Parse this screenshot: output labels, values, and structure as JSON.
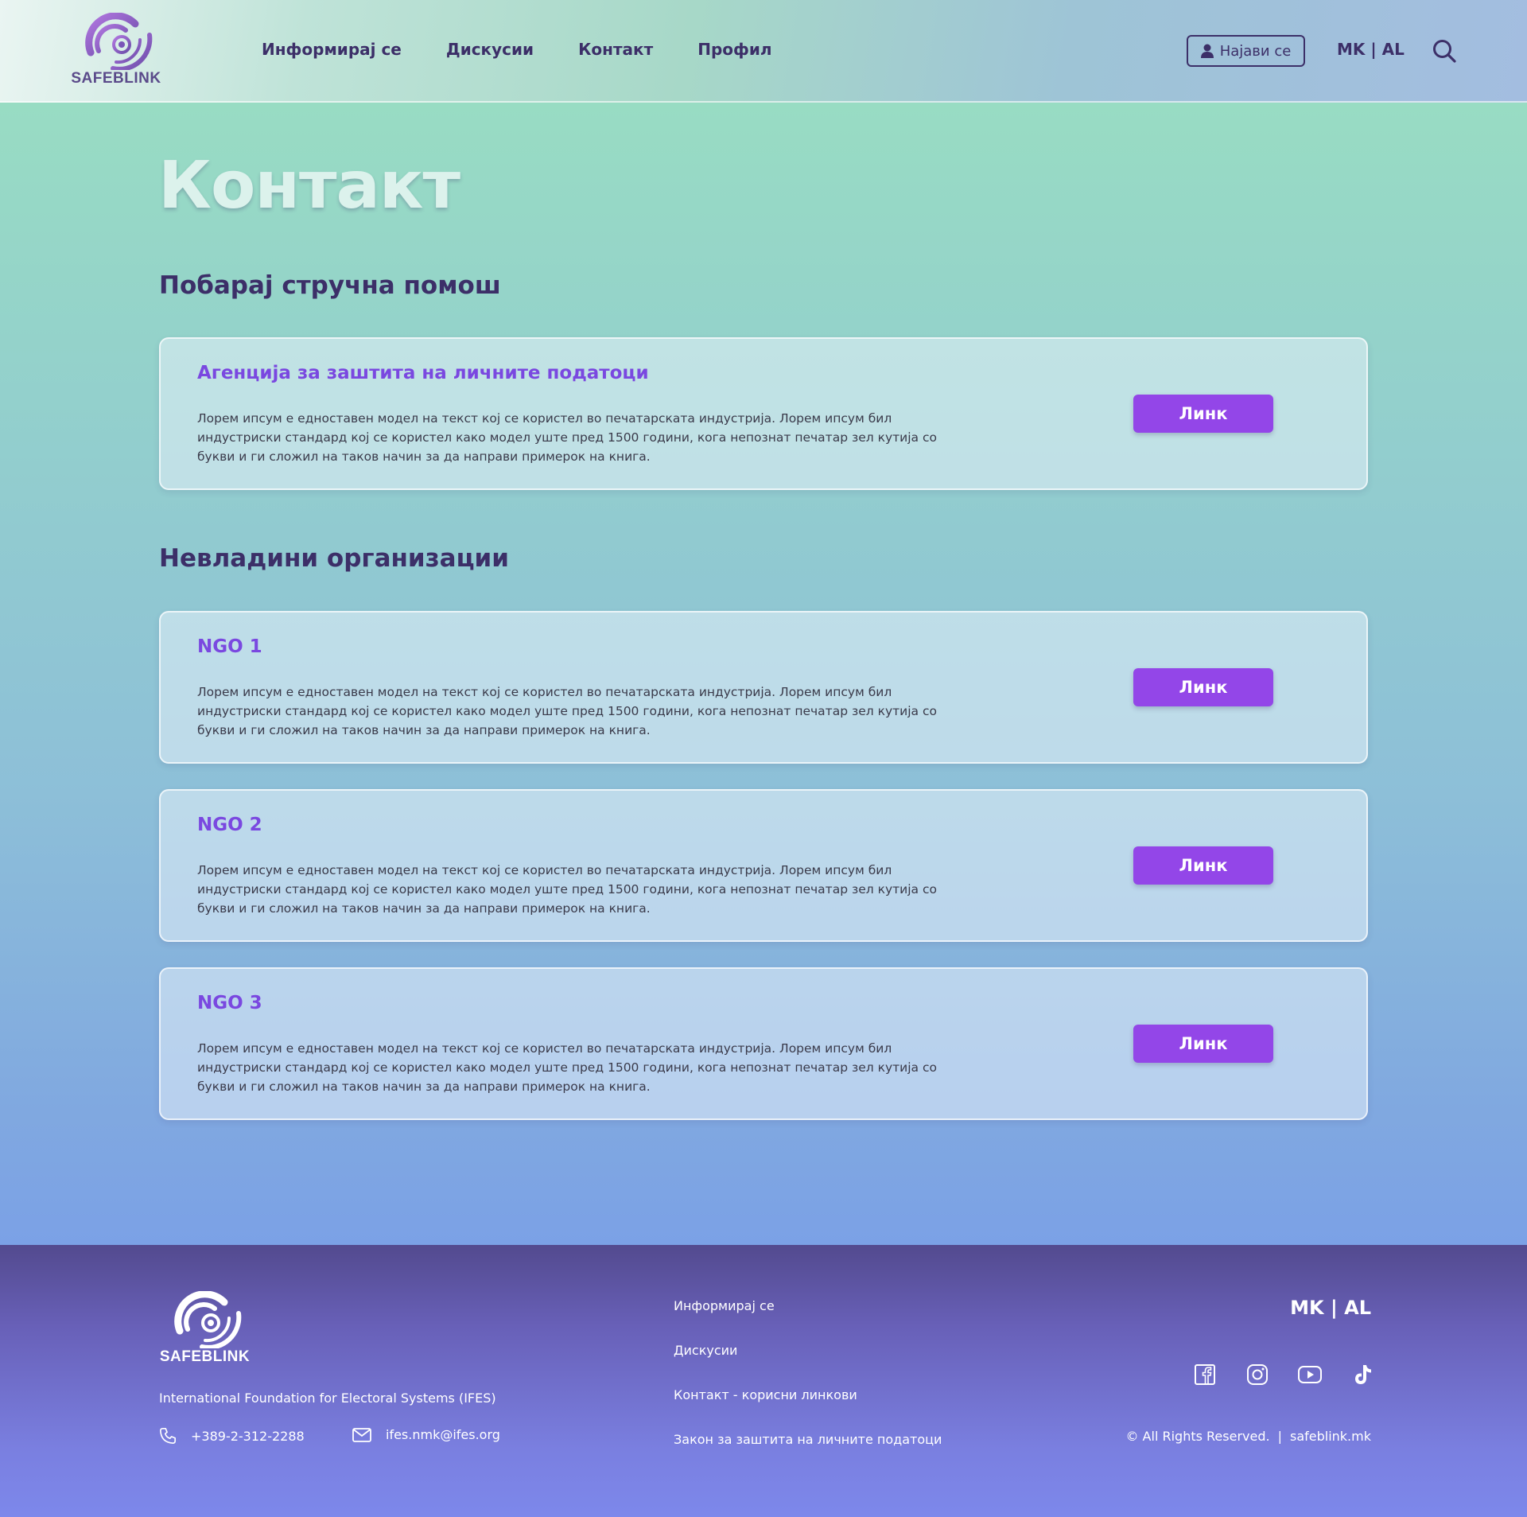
{
  "brand": {
    "name": "SAFEBLINK",
    "accent": "#9346e8",
    "primary_text": "#3c2f68"
  },
  "header": {
    "nav": [
      "Информирај се",
      "Дискусии",
      "Контакт",
      "Профил"
    ],
    "login_label": "Најави се",
    "lang": "MK | AL"
  },
  "main": {
    "title": "Контакт",
    "sections": [
      {
        "title": "Побарај стручна помош",
        "cards": [
          {
            "title": "Агенција за заштита на личните податоци",
            "desc": "Лорем ипсум е едноставен модел на текст кој се користел во печатарската индустрија. Лорем ипсум бил индустриски стандард кој се користел како модел уште пред 1500 години, кога непознат печатар зел кутија со букви и ги сложил на таков начин за да направи примерок на книга.",
            "button": "Линк"
          }
        ]
      },
      {
        "title": "Невладини организации",
        "cards": [
          {
            "title": "NGO 1",
            "desc": "Лорем ипсум е едноставен модел на текст кој се користел во печатарската индустрија. Лорем ипсум бил индустриски стандард кој се користел како модел уште пред 1500 години, кога непознат печатар зел кутија со букви и ги сложил на таков начин за да направи примерок на книга.",
            "button": "Линк"
          },
          {
            "title": "NGO 2",
            "desc": "Лорем ипсум е едноставен модел на текст кој се користел во печатарската индустрија. Лорем ипсум бил индустриски стандард кој се користел како модел уште пред 1500 години, кога непознат печатар зел кутија со букви и ги сложил на таков начин за да направи примерок на книга.",
            "button": "Линк"
          },
          {
            "title": "NGO 3",
            "desc": "Лорем ипсум е едноставен модел на текст кој се користел во печатарската индустрија. Лорем ипсум бил индустриски стандард кој се користел како модел уште пред 1500 години, кога непознат печатар зел кутија со букви и ги сложил на таков начин за да направи примерок на книга.",
            "button": "Линк"
          }
        ]
      }
    ]
  },
  "footer": {
    "org": "International Foundation for Electoral Systems (IFES)",
    "phone": "+389-2-312-2288",
    "email": "ifes.nmk@ifes.org",
    "links": [
      "Информирај се",
      "Дискусии",
      "Контакт - корисни линкови",
      "Закон за заштита на личните податоци"
    ],
    "lang": "MK | AL",
    "socials": [
      "facebook-icon",
      "instagram-icon",
      "youtube-icon",
      "tiktok-icon"
    ],
    "copyright": "© All Rights Reserved.",
    "separator": "|",
    "site": "safeblink.mk"
  }
}
